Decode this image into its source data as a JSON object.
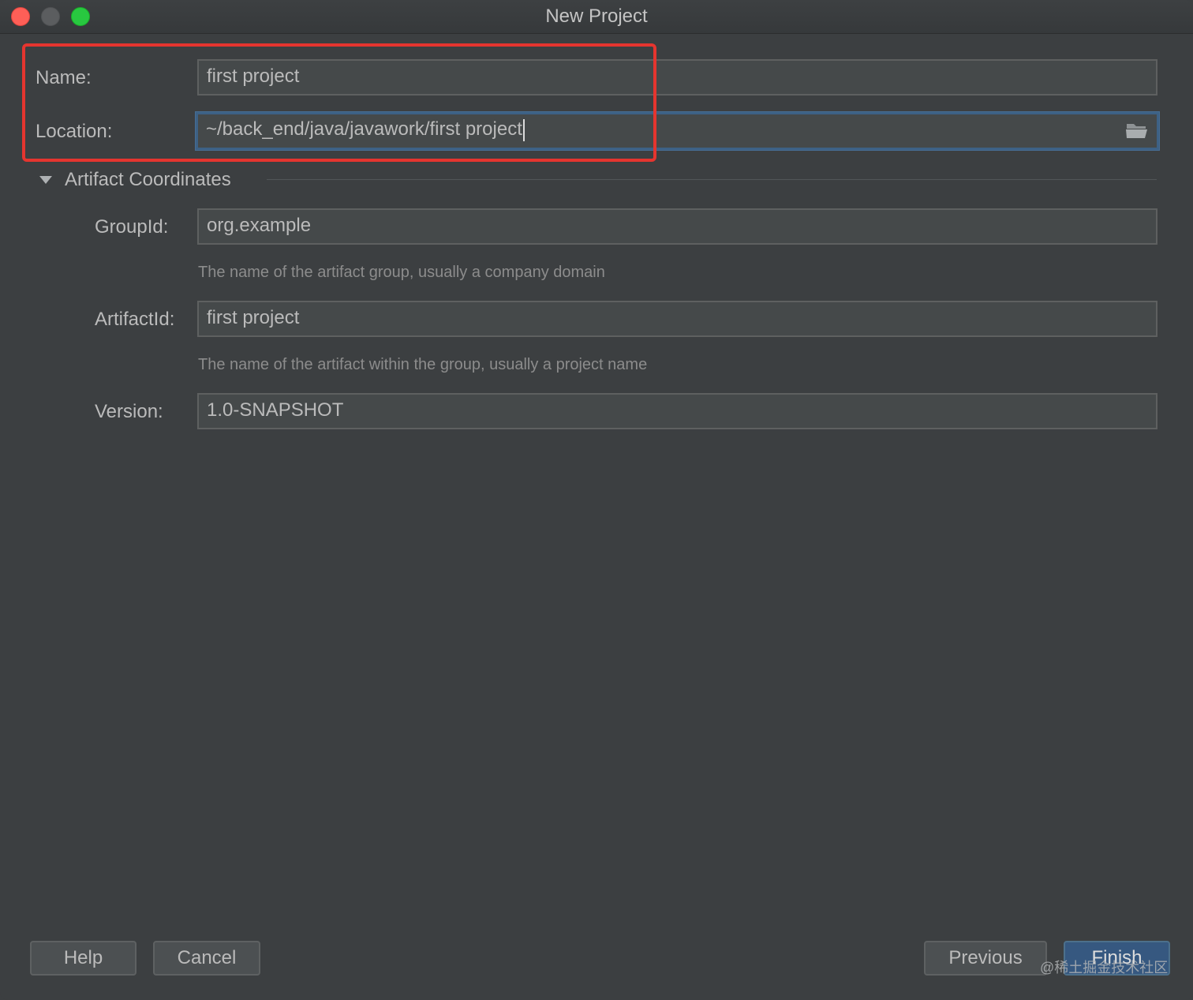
{
  "window": {
    "title": "New Project"
  },
  "form": {
    "name_label": "Name:",
    "name_value": "first project",
    "location_label": "Location:",
    "location_value": "~/back_end/java/javawork/first project"
  },
  "artifact": {
    "section_title": "Artifact Coordinates",
    "groupid_label": "GroupId:",
    "groupid_value": "org.example",
    "groupid_hint": "The name of the artifact group, usually a company domain",
    "artifactid_label": "ArtifactId:",
    "artifactid_value": "first project",
    "artifactid_hint": "The name of the artifact within the group, usually a project name",
    "version_label": "Version:",
    "version_value": "1.0-SNAPSHOT"
  },
  "buttons": {
    "help": "Help",
    "cancel": "Cancel",
    "previous": "Previous",
    "finish": "Finish"
  },
  "watermark": "@稀土掘金技术社区",
  "colors": {
    "background": "#3c3f41",
    "field_bg": "#45494a",
    "focus_border": "#3d6185",
    "highlight_box": "#e5352f",
    "primary_button": "#365880"
  }
}
